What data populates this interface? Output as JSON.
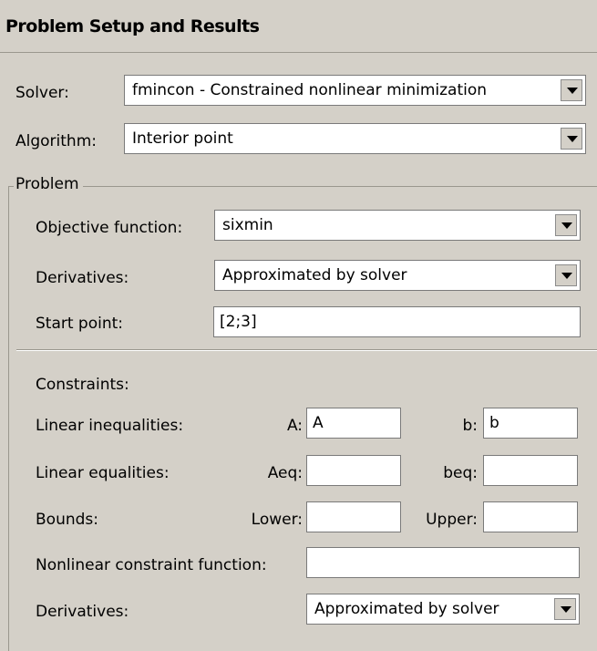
{
  "header": {
    "title": "Problem Setup and Results"
  },
  "solver": {
    "label": "Solver:",
    "value": "fmincon - Constrained nonlinear minimization"
  },
  "algorithm": {
    "label": "Algorithm:",
    "value": "Interior point"
  },
  "problem": {
    "group_title": "Problem",
    "objective": {
      "label": "Objective function:",
      "value": "sixmin"
    },
    "derivatives": {
      "label": "Derivatives:",
      "value": "Approximated by solver"
    },
    "start_point": {
      "label": "Start point:",
      "value": "[2;3]"
    }
  },
  "constraints": {
    "label": "Constraints:",
    "linear_inequalities": {
      "label": "Linear inequalities:",
      "a_label": "A:",
      "a_value": "A",
      "b_label": "b:",
      "b_value": "b"
    },
    "linear_equalities": {
      "label": "Linear equalities:",
      "aeq_label": "Aeq:",
      "aeq_value": "",
      "beq_label": "beq:",
      "beq_value": ""
    },
    "bounds": {
      "label": "Bounds:",
      "lower_label": "Lower:",
      "lower_value": "",
      "upper_label": "Upper:",
      "upper_value": ""
    },
    "nonlinear": {
      "label": "Nonlinear constraint function:",
      "value": ""
    },
    "derivatives": {
      "label": "Derivatives:",
      "value": "Approximated by solver"
    }
  },
  "icons": {
    "dropdown": "chevron-down-icon"
  }
}
